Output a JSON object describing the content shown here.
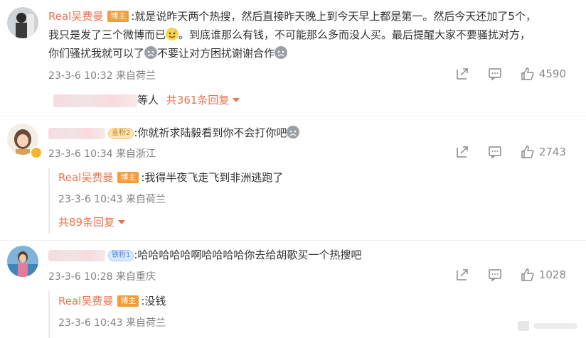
{
  "comment1": {
    "name": "Real吴费曼",
    "badge": "博主",
    "text_a": ":就是说昨天两个热搜，然后直接昨天晚上到今天早上都是第一。然后今天还加了5个，",
    "text_b": "我只是发了三个微博而已",
    "text_c": "。到底谁那么有钱，不可能那么多而没人买。最后提醒大家不要骚扰对方，",
    "text_d": "你们骚扰我就可以了",
    "text_e": "不要让对方困扰谢谢合作",
    "time": "23-3-6 10:32 来自荷兰",
    "like_count": "4590",
    "replies_partial": "等人",
    "replies_more": "共361条回复"
  },
  "comment2": {
    "fan_badge": "金粉2",
    "text": ":你就祈求陆毅看到你不会打你吧",
    "time": "23-3-6 10:34 来自浙江",
    "like_count": "2743",
    "reply": {
      "name": "Real吴费曼",
      "badge": "博主",
      "text": ":我得半夜飞走飞到非洲逃跑了",
      "time": "23-3-6 10:43 来自荷兰"
    },
    "replies_more": "共89条回复"
  },
  "comment3": {
    "fan_badge": "铁粉1",
    "text": ":哈哈哈哈哈啊哈哈哈哈你去给胡歌买一个热搜吧",
    "time": "23-3-6 10:28 来自重庆",
    "like_count": "1028",
    "reply": {
      "name": "Real吴费曼",
      "badge": "博主",
      "text": ":没钱",
      "time": "23-3-6 10:43 来自荷兰"
    }
  },
  "colors": {
    "accent": "#eb7350",
    "host_badge": "#f59b38",
    "meta": "#808080"
  },
  "icons": [
    "share-icon",
    "comment-icon",
    "like-icon",
    "emoji-sweat-icon",
    "emoji-cry-icon",
    "caret-down-icon"
  ]
}
